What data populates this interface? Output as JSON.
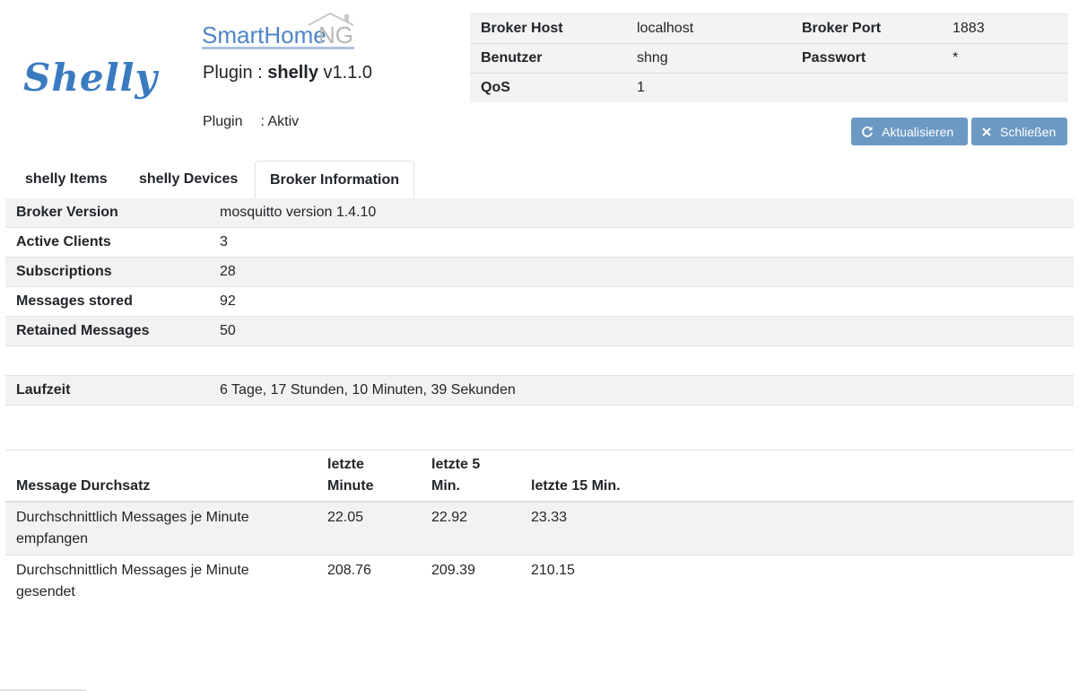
{
  "header": {
    "shelly_logo": "Shelly",
    "shng_logo": "SmartHomeNG",
    "plugin_prefix": "Plugin :",
    "plugin_name": "shelly",
    "plugin_version": "v1.1.0",
    "status_label": "Plugin",
    "status_value": ": Aktiv"
  },
  "info": {
    "broker_host_label": "Broker Host",
    "broker_host_value": "localhost",
    "broker_port_label": "Broker Port",
    "broker_port_value": "1883",
    "user_label": "Benutzer",
    "user_value": "shng",
    "password_label": "Passwort",
    "password_value": "*",
    "qos_label": "QoS",
    "qos_value": "1"
  },
  "buttons": {
    "refresh_label": "Aktualisieren",
    "close_label": "Schließen",
    "color": "#6c99c4"
  },
  "tabs": [
    {
      "label": "shelly Items"
    },
    {
      "label": "shelly Devices"
    },
    {
      "label": "Broker Information"
    }
  ],
  "stats": {
    "broker_version_label": "Broker Version",
    "broker_version_value": "mosquitto version 1.4.10",
    "active_clients_label": "Active Clients",
    "active_clients_value": "3",
    "subscriptions_label": "Subscriptions",
    "subscriptions_value": "28",
    "messages_stored_label": "Messages stored",
    "messages_stored_value": "92",
    "retained_label": "Retained Messages",
    "retained_value": "50",
    "uptime_label": "Laufzeit",
    "uptime_value": "6 Tage, 17 Stunden, 10 Minuten, 39 Sekunden"
  },
  "throughput": {
    "headers": [
      "Message Durchsatz",
      "letzte Minute",
      "letzte 5 Min.",
      "letzte 15 Min."
    ],
    "rows": [
      {
        "label": "Durchschnittlich Messages je Minute empfangen",
        "m1": "22.05",
        "m5": "22.92",
        "m15": "23.33"
      },
      {
        "label": "Durchschnittlich Messages je Minute gesendet",
        "m1": "208.76",
        "m5": "209.39",
        "m15": "210.15"
      }
    ]
  }
}
